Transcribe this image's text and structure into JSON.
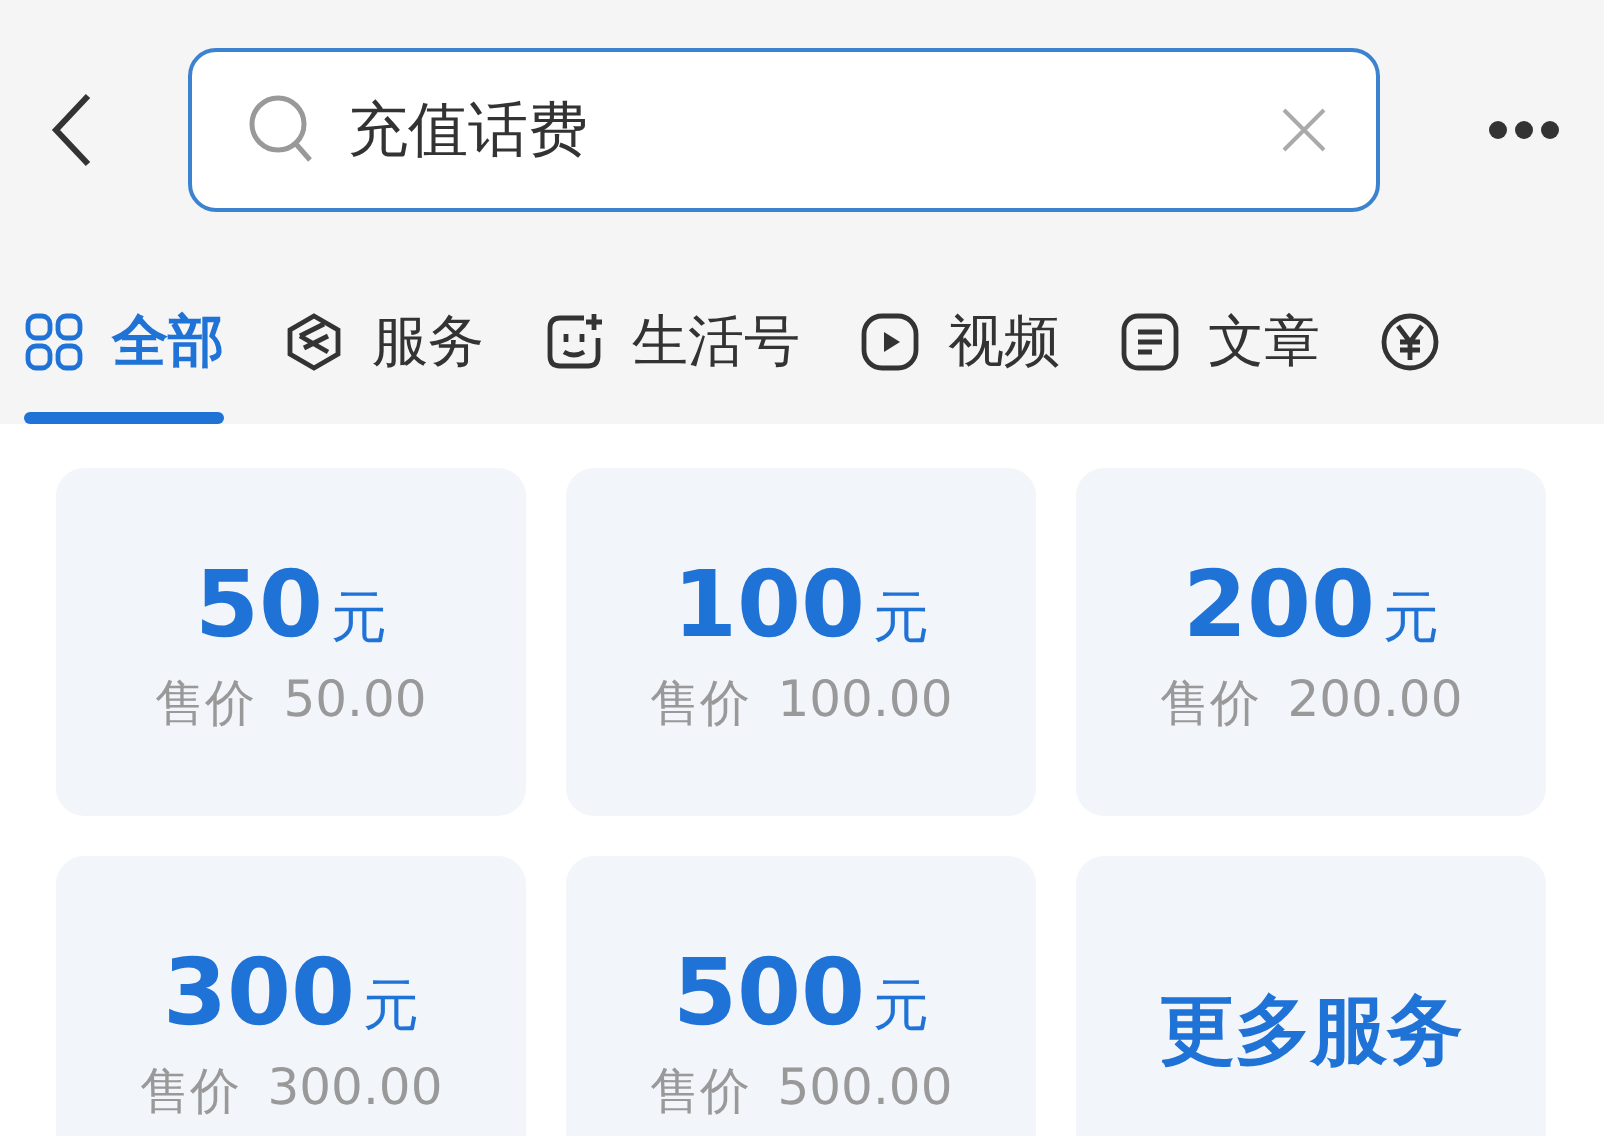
{
  "search": {
    "value": "充值话费"
  },
  "tabs": [
    {
      "kind": "grid",
      "label": "全部",
      "selected": true
    },
    {
      "kind": "cube",
      "label": "服务",
      "selected": false
    },
    {
      "kind": "face",
      "label": "生活号",
      "selected": false
    },
    {
      "kind": "play",
      "label": "视频",
      "selected": false
    },
    {
      "kind": "doc",
      "label": "文章",
      "selected": false
    },
    {
      "kind": "money",
      "selected": false
    }
  ],
  "cards": [
    {
      "kind": "price",
      "amount": "50",
      "unit": "元",
      "price_label": "售价",
      "price": "50.00"
    },
    {
      "kind": "price",
      "amount": "100",
      "unit": "元",
      "price_label": "售价",
      "price": "100.00"
    },
    {
      "kind": "price",
      "amount": "200",
      "unit": "元",
      "price_label": "售价",
      "price": "200.00"
    },
    {
      "kind": "price",
      "amount": "300",
      "unit": "元",
      "price_label": "售价",
      "price": "300.00"
    },
    {
      "kind": "price",
      "amount": "500",
      "unit": "元",
      "price_label": "售价",
      "price": "500.00"
    },
    {
      "kind": "more",
      "label": "更多服务"
    }
  ]
}
